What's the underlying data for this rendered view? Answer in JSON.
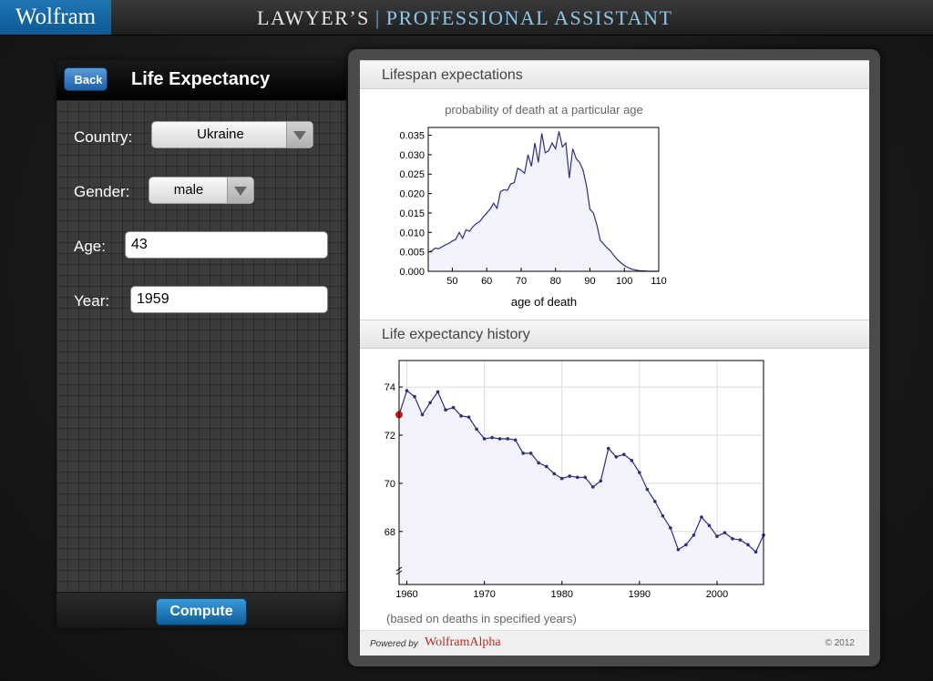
{
  "app": {
    "logo": "Wolfram",
    "title_part1": "LAWYER’S",
    "title_separator": "|",
    "title_part2": "PROFESSIONAL ASSISTANT"
  },
  "form": {
    "back_label": "Back",
    "title": "Life Expectancy",
    "country_label": "Country:",
    "country_value": "Ukraine",
    "gender_label": "Gender:",
    "gender_value": "male",
    "age_label": "Age:",
    "age_value": "43",
    "year_label": "Year:",
    "year_value": "1959",
    "compute_label": "Compute"
  },
  "results": {
    "section1_title": "Lifespan expectations",
    "section2_title": "Life expectancy history",
    "note": "(based on deaths in specified years)",
    "powered_by": "Powered by",
    "brand": "WolframAlpha",
    "copyright": "© 2012"
  },
  "colors": {
    "series": "#2b2f7e",
    "fill": "#f3f3fd",
    "marker": "#d0141e",
    "accent": "#1e6fb1"
  },
  "chart_data": [
    {
      "type": "area",
      "title": "probability of death at a particular age",
      "xlabel": "age of death",
      "ylabel": "",
      "xlim": [
        43,
        110
      ],
      "ylim": [
        0,
        0.037
      ],
      "xticks": [
        "50",
        "60",
        "70",
        "80",
        "90",
        "100",
        "110"
      ],
      "yticks": [
        "0.000",
        "0.005",
        "0.010",
        "0.015",
        "0.020",
        "0.025",
        "0.030",
        "0.035"
      ],
      "x": [
        43,
        44,
        45,
        46,
        47,
        48,
        49,
        50,
        51,
        52,
        53,
        54,
        55,
        56,
        57,
        58,
        59,
        60,
        61,
        62,
        63,
        64,
        65,
        66,
        67,
        68,
        69,
        70,
        71,
        72,
        73,
        74,
        75,
        76,
        77,
        78,
        79,
        80,
        81,
        82,
        83,
        84,
        85,
        86,
        87,
        88,
        89,
        90,
        91,
        92,
        93,
        94,
        95,
        96,
        97,
        98,
        99,
        100,
        101,
        102,
        103,
        104,
        105,
        106,
        107,
        108,
        109,
        110
      ],
      "values": [
        0.005,
        0.0052,
        0.006,
        0.0058,
        0.0063,
        0.0068,
        0.0072,
        0.0078,
        0.0082,
        0.01,
        0.0085,
        0.0107,
        0.0103,
        0.0115,
        0.0123,
        0.0128,
        0.014,
        0.015,
        0.016,
        0.0175,
        0.0162,
        0.0205,
        0.021,
        0.0208,
        0.0225,
        0.0228,
        0.0265,
        0.026,
        0.0252,
        0.03,
        0.027,
        0.033,
        0.028,
        0.0355,
        0.0305,
        0.031,
        0.033,
        0.0315,
        0.036,
        0.032,
        0.033,
        0.024,
        0.0315,
        0.029,
        0.028,
        0.026,
        0.022,
        0.016,
        0.015,
        0.012,
        0.008,
        0.007,
        0.006,
        0.0052,
        0.004,
        0.003,
        0.0022,
        0.0015,
        0.001,
        0.0006,
        0.0004,
        0.0002,
        0.0001,
        0.0001,
        0,
        0,
        0,
        0
      ],
      "grid": false
    },
    {
      "type": "line",
      "title": "",
      "xlabel": "",
      "ylabel": "",
      "xlim": [
        1959,
        2006
      ],
      "ylim": [
        65.8,
        75.1
      ],
      "xticks": [
        "1960",
        "1970",
        "1980",
        "1990",
        "2000"
      ],
      "yticks": [
        "68",
        "70",
        "72",
        "74"
      ],
      "x": [
        1959,
        1960,
        1961,
        1962,
        1963,
        1964,
        1965,
        1966,
        1967,
        1968,
        1969,
        1970,
        1971,
        1972,
        1973,
        1974,
        1975,
        1976,
        1977,
        1978,
        1979,
        1980,
        1981,
        1982,
        1983,
        1984,
        1985,
        1986,
        1987,
        1988,
        1989,
        1990,
        1991,
        1992,
        1993,
        1994,
        1995,
        1996,
        1997,
        1998,
        1999,
        2000,
        2001,
        2002,
        2003,
        2004,
        2005,
        2006
      ],
      "values": [
        72.85,
        73.85,
        73.6,
        72.85,
        73.35,
        73.8,
        73.05,
        73.15,
        72.8,
        72.75,
        72.25,
        71.85,
        71.9,
        71.85,
        71.85,
        71.8,
        71.25,
        71.25,
        70.85,
        70.7,
        70.4,
        70.2,
        70.3,
        70.25,
        70.25,
        69.85,
        70.1,
        71.45,
        71.1,
        71.2,
        70.95,
        70.45,
        69.75,
        69.25,
        68.65,
        68.15,
        67.25,
        67.45,
        67.85,
        68.6,
        68.25,
        67.8,
        67.95,
        67.7,
        67.65,
        67.45,
        67.15,
        67.85
      ],
      "highlight_point": [
        1959,
        72.85
      ],
      "grid": true
    }
  ]
}
